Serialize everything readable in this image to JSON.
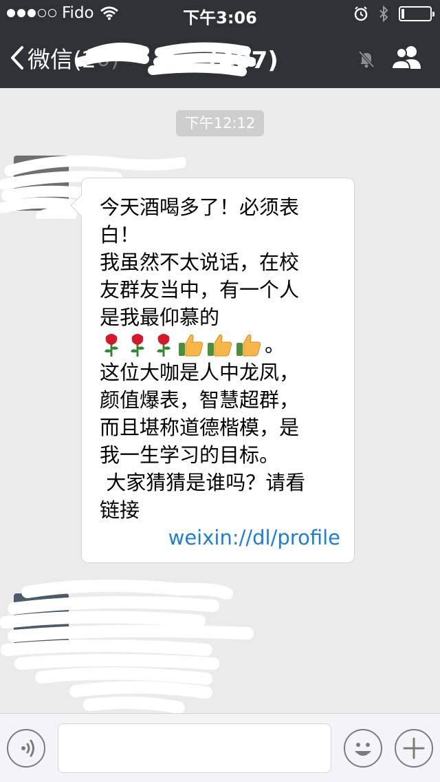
{
  "status_bar": {
    "carrier": "Fido",
    "time": "下午3:06",
    "signal_bars_filled": 3,
    "signal_bars_total": 5,
    "battery_level": 0.1,
    "icons": [
      "wifi-icon",
      "alarm-icon",
      "bluetooth-icon",
      "battery-icon"
    ]
  },
  "nav": {
    "back_label": "微信(2",
    "back_label_suffix": "0)",
    "title_visible": "大...(407)",
    "icons": [
      "chevron-left-icon",
      "mute-bell-icon",
      "group-members-icon"
    ]
  },
  "chat": {
    "timestamp": "下午12:12",
    "message": {
      "lines": [
        "今天酒喝多了！必须表",
        "白！",
        "我虽然不太说话，在校",
        "友群友当中，有一个人",
        "是我最仰慕的"
      ],
      "emoji_row": {
        "items": [
          "rose",
          "rose",
          "rose",
          "thumbs-up",
          "thumbs-up",
          "thumbs-up"
        ],
        "trailing_text": "。"
      },
      "lines_after": [
        "这位大咖是人中龙凤，",
        "颜值爆表，智慧超群，",
        "而且堪称道德楷模，是",
        "我一生学习的目标。",
        " 大家猜猜是谁吗？请看",
        "链接"
      ],
      "link": "weixin://dl/profile"
    }
  },
  "input_bar": {
    "text_value": "",
    "icons": [
      "voice-icon",
      "emoji-icon",
      "plus-icon"
    ]
  },
  "colors": {
    "nav_background": "#2e3136",
    "chat_background": "#ebebeb",
    "link": "#1a7ee0",
    "timestamp_bg": "#cecece"
  }
}
